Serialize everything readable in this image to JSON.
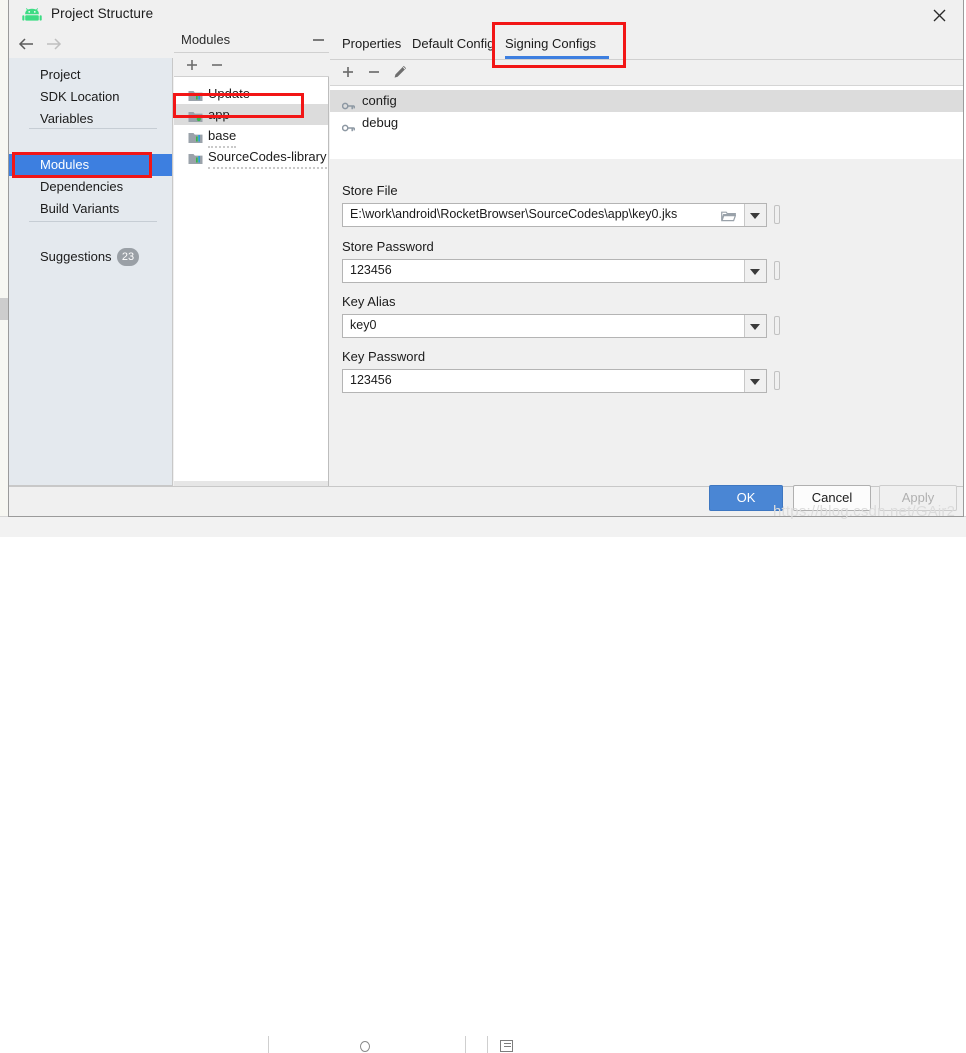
{
  "window": {
    "title": "Project Structure",
    "app_icon": "android-robot-icon",
    "close_icon": "close-icon"
  },
  "nav": {
    "back_icon": "arrow-left-icon",
    "forward_icon": "arrow-right-icon"
  },
  "sidebar": {
    "items": [
      {
        "label": "Project",
        "selected": false
      },
      {
        "label": "SDK Location",
        "selected": false
      },
      {
        "label": "Variables",
        "selected": false
      },
      {
        "label": "Modules",
        "selected": true
      },
      {
        "label": "Dependencies",
        "selected": false
      },
      {
        "label": "Build Variants",
        "selected": false
      }
    ],
    "suggestions": {
      "label": "Suggestions",
      "badge": "23"
    }
  },
  "modules_panel": {
    "title": "Modules",
    "collapse_icon": "minimize-icon",
    "toolbar": {
      "add_icon": "plus-icon",
      "remove_icon": "minus-icon"
    },
    "items": [
      {
        "label": "Update",
        "icon": "module-icon",
        "selected": false
      },
      {
        "label": "app",
        "icon": "android-module-icon",
        "selected": true
      },
      {
        "label": "base",
        "icon": "module-icon",
        "selected": false
      },
      {
        "label": "SourceCodes-library",
        "icon": "module-icon",
        "selected": false
      }
    ]
  },
  "content": {
    "tabs": [
      {
        "label": "Properties",
        "selected": false
      },
      {
        "label": "Default Config",
        "selected": false
      },
      {
        "label": "Signing Configs",
        "selected": true
      }
    ],
    "toolbar": {
      "add_icon": "plus-icon",
      "remove_icon": "minus-icon",
      "edit_icon": "pencil-icon"
    },
    "configs": [
      {
        "label": "config",
        "icon": "key-icon",
        "selected": true
      },
      {
        "label": "debug",
        "icon": "key-icon",
        "selected": false
      }
    ],
    "fields": [
      {
        "label": "Store File",
        "value": "E:\\work\\android\\RocketBrowser\\SourceCodes\\app\\key0.jks",
        "browse_icon": "folder-icon",
        "dropdown_icon": "chevron-down-icon"
      },
      {
        "label": "Store Password",
        "value": "123456",
        "dropdown_icon": "chevron-down-icon"
      },
      {
        "label": "Key Alias",
        "value": "key0",
        "dropdown_icon": "chevron-down-icon"
      },
      {
        "label": "Key Password",
        "value": "123456",
        "dropdown_icon": "chevron-down-icon"
      }
    ]
  },
  "buttons": {
    "ok": "OK",
    "cancel": "Cancel",
    "apply": "Apply"
  },
  "watermark": "https://blog.csdn.net/GAir2",
  "colors": {
    "accent_blue": "#3d7fe0",
    "ok_button": "#4a86d4",
    "annotation_red": "#f21616",
    "sidebar_bg": "#e4e9ee",
    "android_green": "#3ddc84"
  }
}
